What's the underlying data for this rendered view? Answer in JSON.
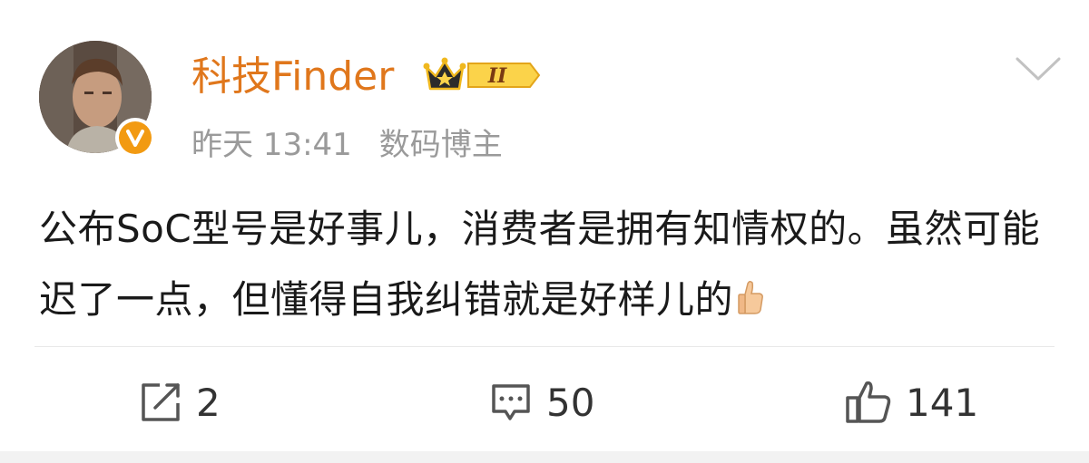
{
  "post": {
    "username": "科技Finder",
    "timestamp": "昨天 13:41",
    "source": "数码博主",
    "content": "公布SoC型号是好事儿，消费者是拥有知情权的。虽然可能迟了一点，但懂得自我纠错就是好样儿的",
    "badge_level": "II",
    "emoji": "thumbs-up"
  },
  "actions": {
    "repost_count": "2",
    "comment_count": "50",
    "like_count": "141"
  },
  "colors": {
    "username": "#e0771c",
    "verified": "#f29a12",
    "meta": "#9a9a9a",
    "text": "#1a1a1a"
  },
  "icons": {
    "verified": "verified-v-icon",
    "badge": "crown-badge-icon",
    "menu": "chevron-down-icon",
    "repost": "repost-icon",
    "comment": "comment-icon",
    "like": "thumbs-up-icon"
  }
}
